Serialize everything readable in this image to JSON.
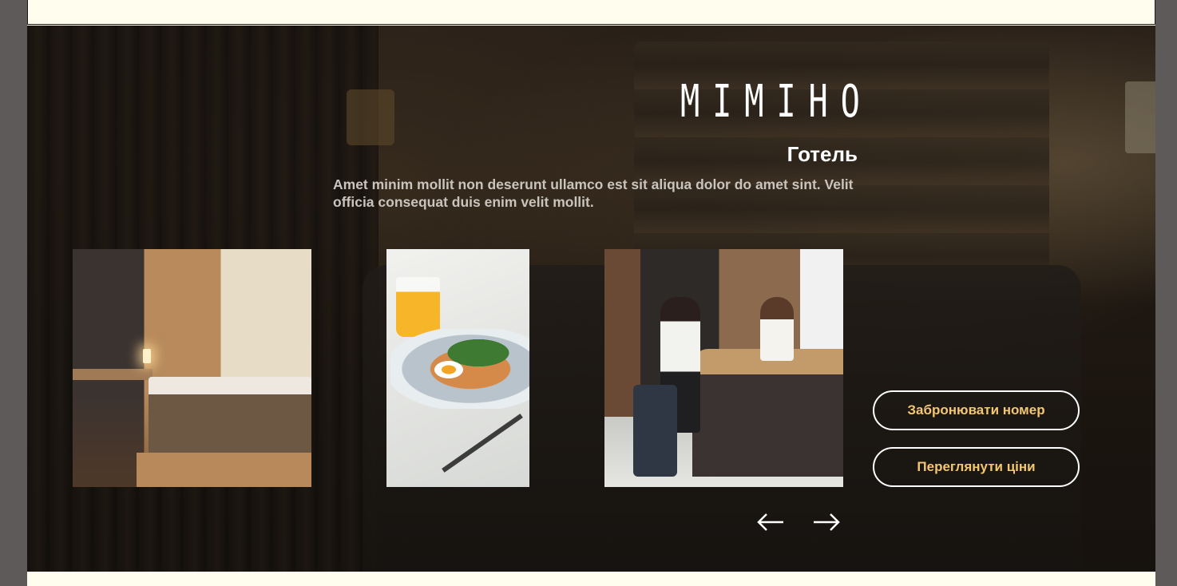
{
  "brand": {
    "logo_text": "MIMIHO",
    "title": "Готель",
    "description": "Amet minim mollit non deserunt ullamco est sit aliqua dolor do amet sint. Velit officia consequat duis enim velit mollit."
  },
  "gallery": {
    "images": [
      {
        "name": "hotel-room-photo"
      },
      {
        "name": "breakfast-photo"
      },
      {
        "name": "reception-photo"
      }
    ]
  },
  "actions": {
    "book_label": "Забронювати номер",
    "prices_label": "Переглянути ціни"
  },
  "navigation": {
    "prev_icon": "arrow-left-icon",
    "next_icon": "arrow-right-icon"
  },
  "colors": {
    "accent": "#f3c770",
    "page_background": "#fffdee",
    "text_primary": "#ffffff",
    "text_secondary": "#c9c4bd"
  }
}
